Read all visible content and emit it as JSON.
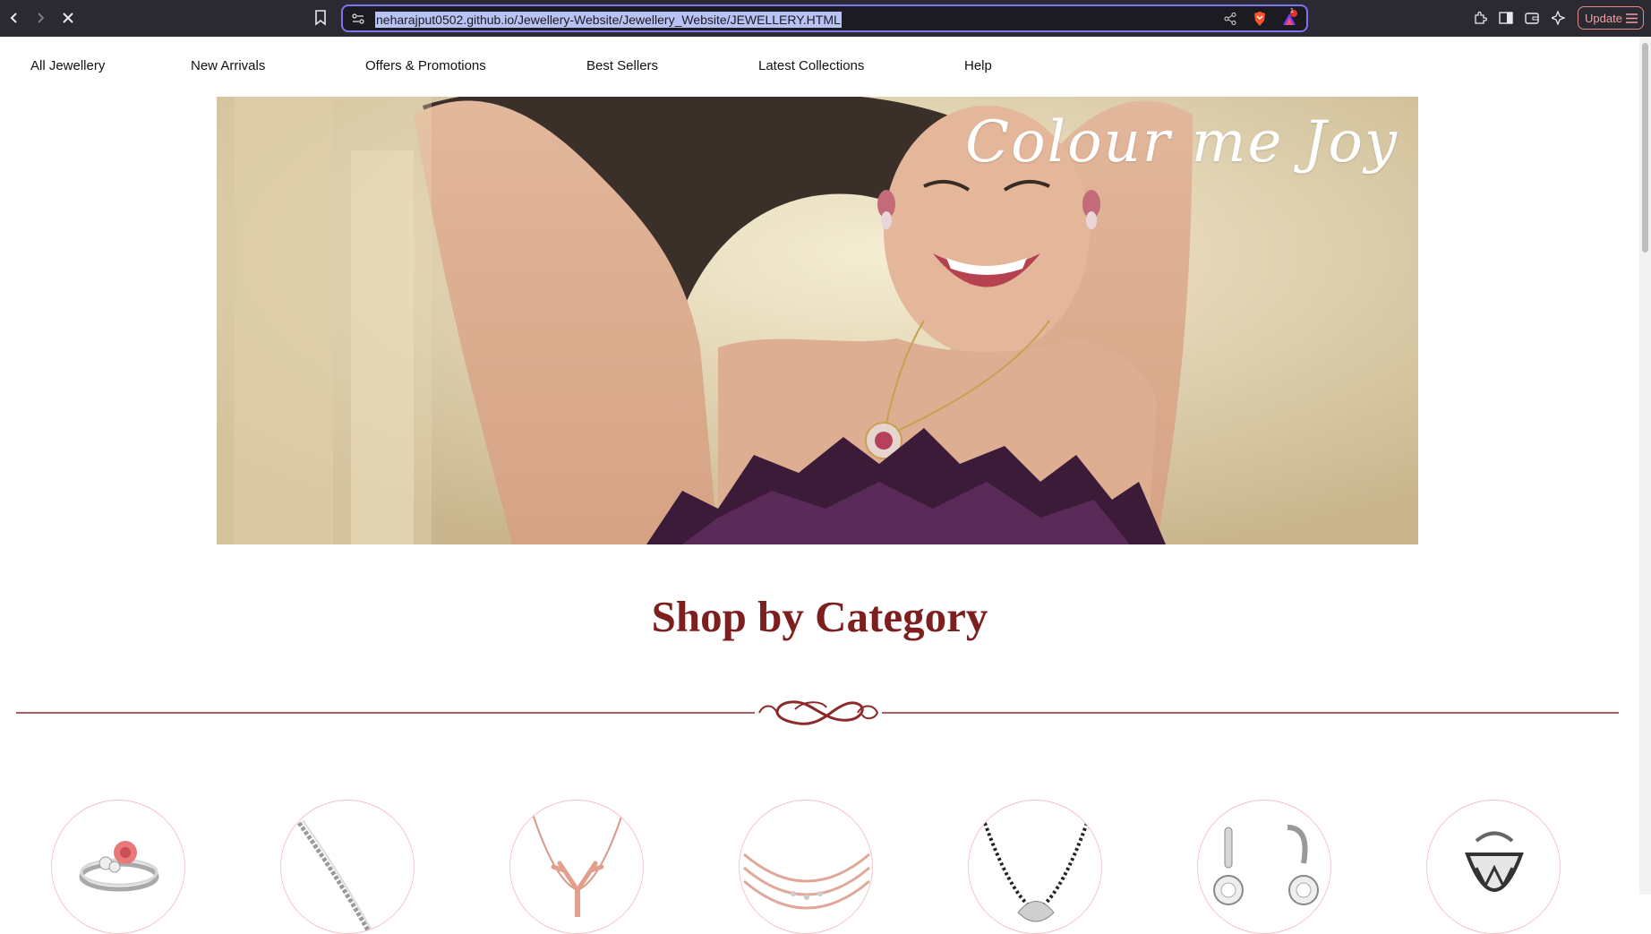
{
  "browser": {
    "url": "neharajput0502.github.io/Jewellery-Website/Jewellery_Website/JEWELLERY.HTML",
    "update_label": "Update",
    "notification_count": "1"
  },
  "nav": {
    "items": [
      {
        "label": "All Jewellery"
      },
      {
        "label": "New Arrivals"
      },
      {
        "label": "Offers & Promotions"
      },
      {
        "label": "Best Sellers"
      },
      {
        "label": "Latest Collections"
      },
      {
        "label": "Help"
      }
    ]
  },
  "hero": {
    "script_text": "Colour me Joy"
  },
  "section": {
    "title": "Shop by Category"
  },
  "categories": [
    {
      "icon": "ring-icon"
    },
    {
      "icon": "bracelet-icon"
    },
    {
      "icon": "pendant-necklace-icon"
    },
    {
      "icon": "chain-necklace-icon"
    },
    {
      "icon": "mangalsutra-icon"
    },
    {
      "icon": "earrings-icon"
    },
    {
      "icon": "hoop-earring-icon"
    }
  ],
  "colors": {
    "accent": "#7d1f1f",
    "circle_border": "#f3c4c8",
    "chrome_bg": "#2b2a33",
    "url_focus": "#7b73f0"
  }
}
